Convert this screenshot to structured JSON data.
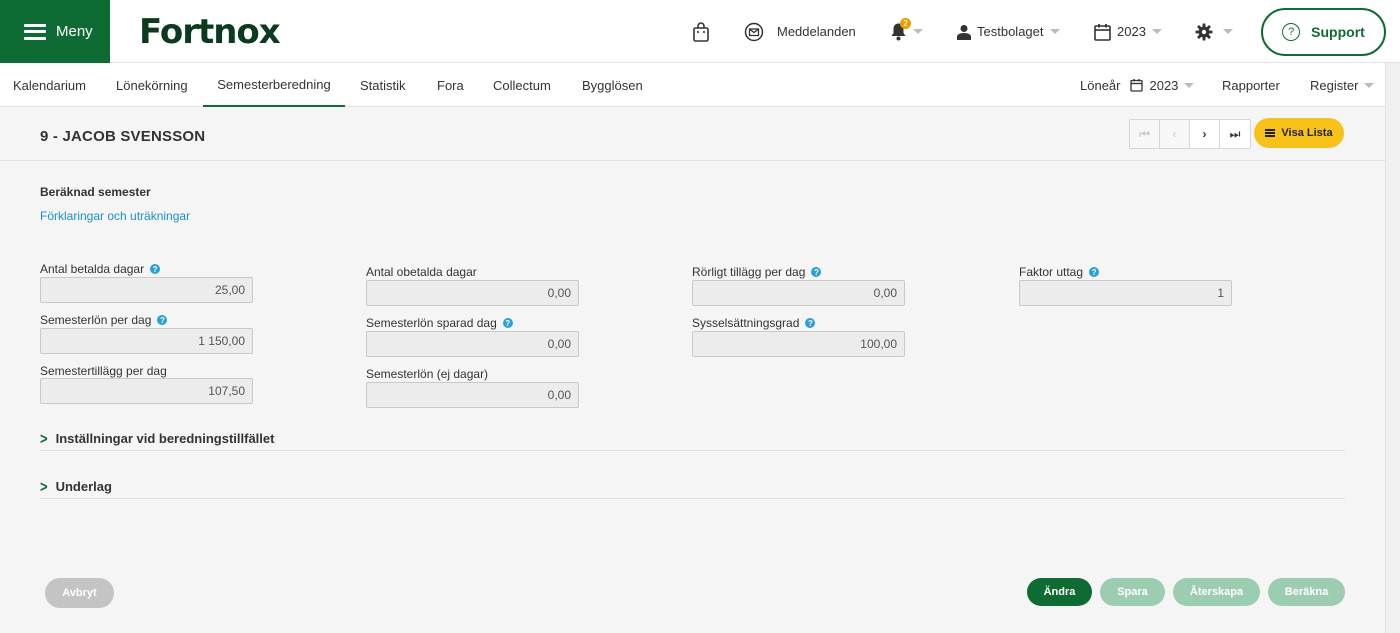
{
  "header": {
    "menu_label": "Meny",
    "logo_text": "Fortnox",
    "messages_label": "Meddelanden",
    "notification_count": "2",
    "company": "Testbolaget",
    "year": "2023",
    "support_label": "Support"
  },
  "subnav": {
    "tabs": [
      {
        "label": "Kalendarium"
      },
      {
        "label": "Lönekörning"
      },
      {
        "label": "Semesterberedning"
      },
      {
        "label": "Statistik"
      },
      {
        "label": "Fora"
      },
      {
        "label": "Collectum"
      },
      {
        "label": "Bygglösen"
      }
    ],
    "active_tab": "Semesterberedning",
    "loneaar_label": "Löneår",
    "loneaar_year": "2023",
    "rapporter": "Rapporter",
    "register": "Register"
  },
  "page": {
    "title": "9 - JACOB SVENSSON",
    "visa_lista": "Visa Lista",
    "section_title": "Beräknad semester",
    "explain_link": "Förklaringar och uträkningar"
  },
  "fields": {
    "antal_betalda_dagar": {
      "label": "Antal betalda dagar",
      "value": "25,00"
    },
    "semesterlon_per_dag": {
      "label": "Semesterlön per dag",
      "value": "1 150,00"
    },
    "semestertillagg_per_dag": {
      "label": "Semestertillägg per dag",
      "value": "107,50"
    },
    "antal_obetalda_dagar": {
      "label": "Antal obetalda dagar",
      "value": "0,00"
    },
    "semesterlon_sparad_dag": {
      "label": "Semesterlön sparad dag",
      "value": "0,00"
    },
    "semesterlon_ej_dagar": {
      "label": "Semesterlön (ej dagar)",
      "value": "0,00"
    },
    "rorligt_tillagg": {
      "label": "Rörligt tillägg per dag",
      "value": "0,00"
    },
    "sysselsattningsgrad": {
      "label": "Sysselsättningsgrad",
      "value": "100,00"
    },
    "faktor_uttag": {
      "label": "Faktor uttag",
      "value": "1"
    }
  },
  "sections": {
    "installningar": "Inställningar vid beredningstillfället",
    "underlag": "Underlag"
  },
  "buttons": {
    "avbryt": "Avbryt",
    "andra": "Ändra",
    "spara": "Spara",
    "aterskapa": "Återskapa",
    "berakna": "Beräkna"
  },
  "colors": {
    "brand_green": "#0e6b33",
    "light_green": "#9ccdb0",
    "yellow": "#f6c21a",
    "link_blue": "#1a8fc8"
  }
}
